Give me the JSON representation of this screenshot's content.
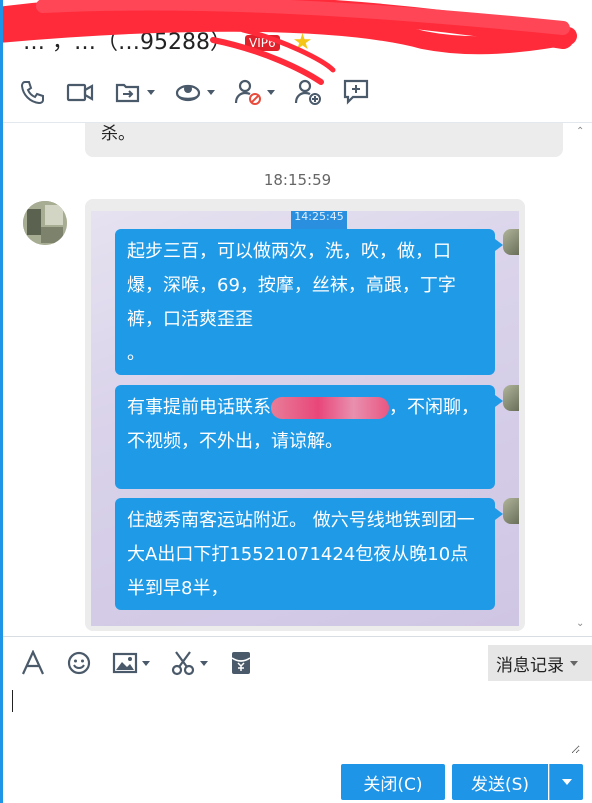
{
  "header": {
    "title_visible": "… ，…（…95288）",
    "vip_badge": "VIP6",
    "toolbar": [
      {
        "name": "phone-icon"
      },
      {
        "name": "video-icon"
      },
      {
        "name": "file-transfer-icon"
      },
      {
        "name": "remote-assist-icon"
      },
      {
        "name": "block-user-icon"
      },
      {
        "name": "add-friend-icon"
      },
      {
        "name": "chat-bubble-icon"
      }
    ]
  },
  "chat": {
    "previous_message_tail": "杀。",
    "timestamp": "18:15:59",
    "image_time_label": "14:25:45",
    "messages": [
      {
        "text": "起步三百，可以做两次，洗，吹，做，口爆，深喉，69，按摩，丝袜，高跟，丁字裤，口活爽歪歪\n。"
      },
      {
        "text_before": "有事提前电话联系",
        "text_after": "，不闲聊，不视频，不外出，请谅解。"
      },
      {
        "text": "住越秀南客运站附近。 做六号线地铁到团一大A出口下打15521071424包夜从晚10点半到早8半，"
      }
    ]
  },
  "input": {
    "history_label": "消息记录",
    "close_label": "关闭(C)",
    "send_label": "发送(S)",
    "value": ""
  },
  "colors": {
    "accent": "#1f95e8",
    "bubble_blue": "#1f9ae6",
    "scribble_red": "#ff2b3a"
  }
}
